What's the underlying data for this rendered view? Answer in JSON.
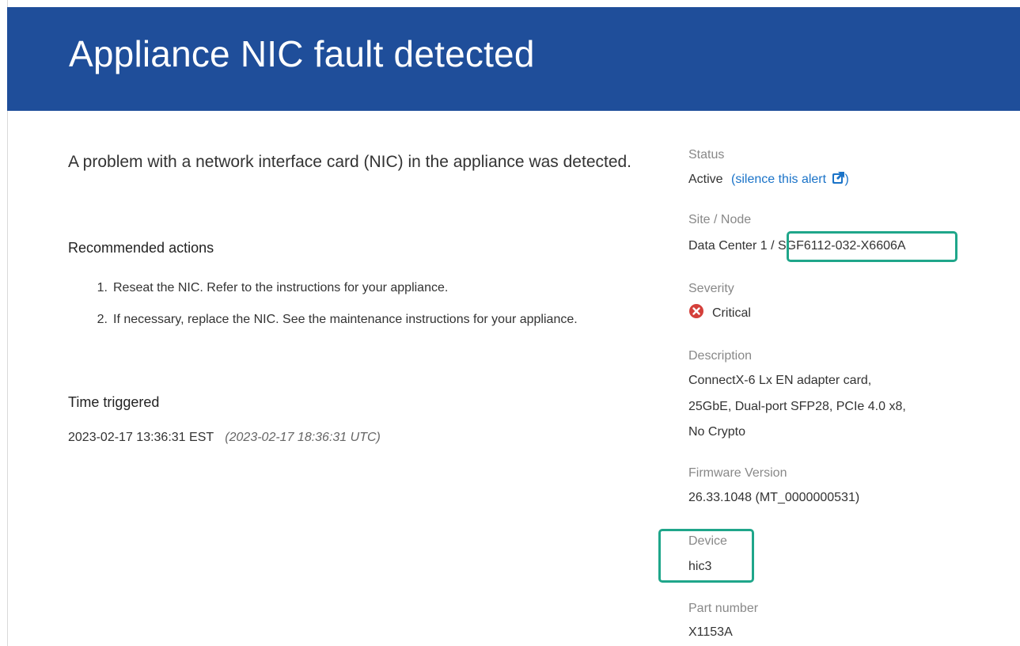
{
  "header": {
    "title": "Appliance NIC fault detected"
  },
  "summary": {
    "text": "A problem with a network interface card (NIC) in the appliance was detected."
  },
  "recommended_actions": {
    "heading": "Recommended actions",
    "items": [
      {
        "number": "1.",
        "text": "Reseat the NIC. Refer to the instructions for your appliance."
      },
      {
        "number": "2.",
        "text": "If necessary, replace the NIC. See the maintenance instructions for your appliance."
      }
    ]
  },
  "time_triggered": {
    "heading": "Time triggered",
    "local": "2023-02-17 13:36:31 EST",
    "utc": "(2023-02-17 18:36:31 UTC)"
  },
  "details": {
    "status": {
      "label": "Status",
      "value": "Active",
      "link_open": "(",
      "link_text": "silence this alert",
      "link_close": ")"
    },
    "site_node": {
      "label": "Site / Node",
      "site": "Data Center 1",
      "separator": "/",
      "node": "SGF6112-032-X6606A"
    },
    "severity": {
      "label": "Severity",
      "value": "Critical",
      "icon": "critical-x-icon",
      "color": "#d43f3a"
    },
    "description": {
      "label": "Description",
      "lines": [
        "ConnectX-6 Lx EN adapter card,",
        "25GbE, Dual-port SFP28, PCIe 4.0 x8,",
        "No Crypto"
      ]
    },
    "firmware": {
      "label": "Firmware Version",
      "value": "26.33.1048 (MT_0000000531)"
    },
    "device": {
      "label": "Device",
      "value": "hic3"
    },
    "part_number": {
      "label": "Part number",
      "value": "X1153A"
    }
  },
  "colors": {
    "header_bg": "#1f4e9a",
    "link": "#1a73c8",
    "highlight": "#1fa68a"
  }
}
